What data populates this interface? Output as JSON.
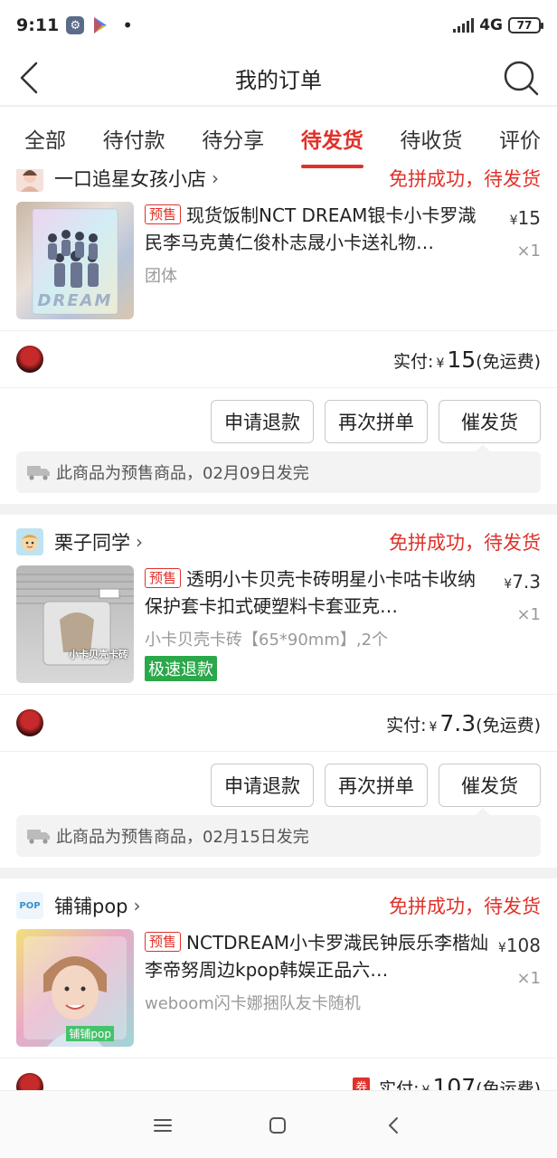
{
  "status_bar": {
    "time": "9:11",
    "network": "4G",
    "battery": "77"
  },
  "header": {
    "title": "我的订单"
  },
  "tabs": [
    {
      "label": "全部"
    },
    {
      "label": "待付款"
    },
    {
      "label": "待分享"
    },
    {
      "label": "待发货",
      "active": true
    },
    {
      "label": "待收货"
    },
    {
      "label": "评价"
    }
  ],
  "orders": [
    {
      "shop": "一口追星女孩小店",
      "status": "免拼成功，待发货",
      "badge": "预售",
      "title": "现货饭制NCT DREAM银卡小卡罗渽民李马克黄仁俊朴志晟小卡送礼物…",
      "spec": "团体",
      "price_symbol": "¥",
      "price": "15",
      "qty": "×1",
      "paid_label": "实付:",
      "paid_symbol": "¥",
      "paid_amount": "15",
      "shipping": "(免运费)",
      "buttons": [
        "申请退款",
        "再次拼单",
        "催发货"
      ],
      "notice": "此商品为预售商品，02月09日发完"
    },
    {
      "shop": "栗子同学",
      "status": "免拼成功，待发货",
      "badge": "预售",
      "title": "透明小卡贝壳卡砖明星小卡咕卡收纳保护套卡扣式硬塑料卡套亚克…",
      "spec": "小卡贝壳卡砖【65*90mm】,2个",
      "quick": "极速退款",
      "price_symbol": "¥",
      "price": "7.3",
      "qty": "×1",
      "paid_label": "实付:",
      "paid_symbol": "¥",
      "paid_amount": "7.3",
      "shipping": "(免运费)",
      "buttons": [
        "申请退款",
        "再次拼单",
        "催发货"
      ],
      "notice": "此商品为预售商品，02月15日发完",
      "thumb_text": "小卡贝壳卡砖"
    },
    {
      "shop": "铺铺pop",
      "status": "免拼成功，待发货",
      "badge": "预售",
      "title": "NCTDREAM小卡罗渽民钟辰乐李楷灿李帝努周边kpop韩娱正品六…",
      "spec": "weboom闪卡娜捆队友卡随机",
      "price_symbol": "¥",
      "price": "108",
      "qty": "×1",
      "coupon": "券",
      "paid_label": "实付:",
      "paid_symbol": "¥",
      "paid_amount": "107",
      "shipping": "(免运费)",
      "thumb_text": "铺铺pop",
      "shop_avatar_text": "POP"
    }
  ],
  "thumb1_text": "DREAM",
  "icons": {
    "back": "chevron-left-icon",
    "search": "search-icon",
    "truck": "truck-icon",
    "menu": "menu-icon",
    "home": "home-icon",
    "back_nav": "back-icon"
  },
  "colors": {
    "accent": "#e0312a",
    "quick_refund": "#2aa84a"
  }
}
